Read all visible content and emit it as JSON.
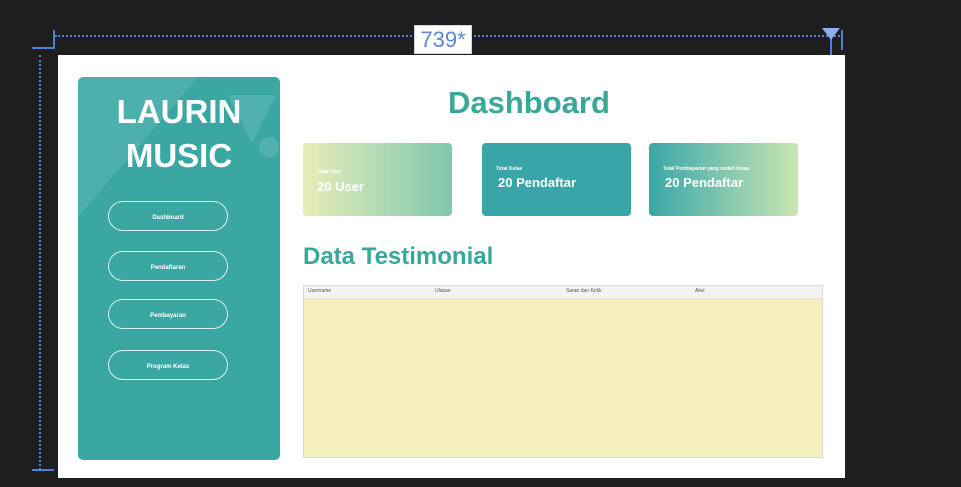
{
  "designer": {
    "width_label": "739*"
  },
  "sidebar": {
    "brand_line1": "LAURIN",
    "brand_line2": "MUSIC",
    "nav": [
      {
        "label": "Dashboard"
      },
      {
        "label": "Pendaftaran"
      },
      {
        "label": "Pembayaran"
      },
      {
        "label": "Program Kelas"
      }
    ]
  },
  "main": {
    "title": "Dashboard",
    "cards": [
      {
        "label": "Total User",
        "value": "20 User"
      },
      {
        "label": "Total Kelas",
        "value": "20 Pendaftar"
      },
      {
        "label": "Total Pembayaran yang sudah lunas",
        "value": "20 Pendaftar"
      }
    ],
    "testimonial_title": "Data Testimonial",
    "table_headers": [
      "Username",
      "Ulasan",
      "Saran dan Kritik",
      "Aksi"
    ]
  },
  "colors": {
    "accent": "#37a899",
    "sidebar": "#3aa7a3",
    "table_body": "#f5eebd",
    "guide": "#4f7fd6"
  }
}
